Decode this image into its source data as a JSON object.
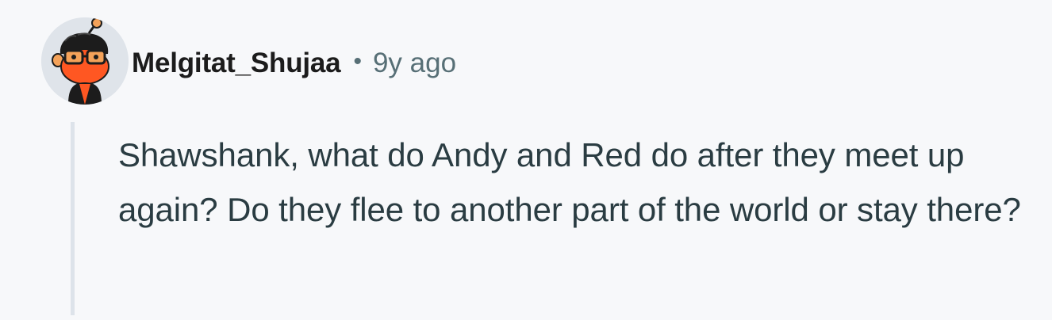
{
  "comment": {
    "author": "Melgitat_Shujaa",
    "separator": "•",
    "age": "9y ago",
    "avatar_icon": "snoo-avatar-icon",
    "body": "Shawshank, what do Andy and Red do after they meet up again? Do they flee to another part of the world or stay there?"
  },
  "colors": {
    "background": "#f7f8fa",
    "author": "#1c1c1c",
    "meta": "#576f76",
    "body": "#2a3c42",
    "thread_line": "#dde3ea"
  }
}
